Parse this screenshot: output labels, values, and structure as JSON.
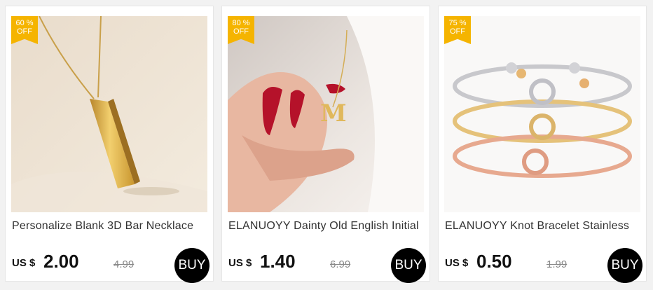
{
  "colors": {
    "badge": "#f5b400",
    "buy_button": "#000000"
  },
  "products": [
    {
      "discount": "60 %",
      "off_label": "OFF",
      "title": "Personalize Blank 3D Bar  Necklace",
      "currency": "US $",
      "price": "2.00",
      "old_price": "4.99",
      "buy_label": "BUY",
      "image": "gold-bar-necklace"
    },
    {
      "discount": "80 %",
      "off_label": "OFF",
      "title": "ELANUOYY Dainty Old English Initial",
      "currency": "US $",
      "price": "1.40",
      "old_price": "6.99",
      "buy_label": "BUY",
      "image": "initial-pendant-in-hand"
    },
    {
      "discount": "75 %",
      "off_label": "OFF",
      "title": "ELANUOYY Knot Bracelet Stainless",
      "currency": "US $",
      "price": "0.50",
      "old_price": "1.99",
      "buy_label": "BUY",
      "image": "knot-bangle-bracelets"
    }
  ]
}
